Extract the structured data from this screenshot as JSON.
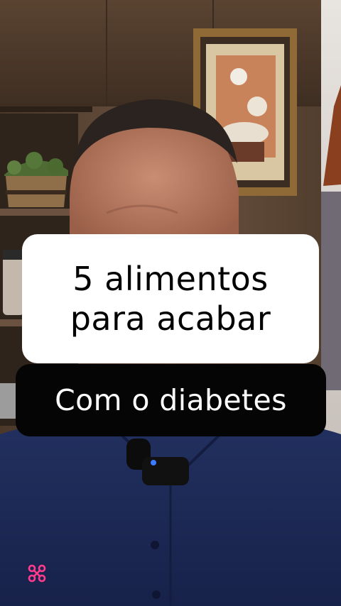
{
  "video": {
    "caption_lines": [
      "5 alimentos",
      "para acabar"
    ],
    "subtitle": "Com o diabetes"
  },
  "colors": {
    "caption_bg": "#ffffff",
    "caption_text": "#000000",
    "subtitle_bg": "#050505",
    "subtitle_text": "#ffffff",
    "shirt": "#1c2a5c",
    "wall": "#5e4836",
    "watermark": "#ff3b8d"
  },
  "icons": {
    "watermark": "brand-watermark-icon",
    "microphone": "lapel-microphone-icon"
  }
}
